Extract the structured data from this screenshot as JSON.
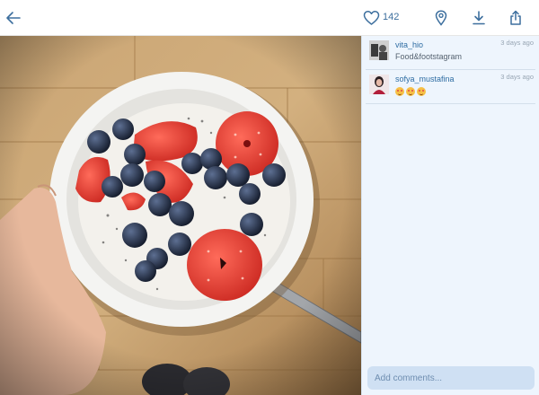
{
  "topbar": {
    "back_icon": "arrow-left-icon",
    "like_icon": "heart-outline-icon",
    "like_count": "142",
    "location_icon": "map-pin-icon",
    "download_icon": "download-icon",
    "share_icon": "share-icon",
    "accent_color": "#3d6f9e"
  },
  "photo": {
    "subject": "bowl of strawberries, blueberries and dragon fruit held in hand"
  },
  "comments": [
    {
      "username": "vita_hio",
      "text": "Food&footstagram",
      "time": "3 days ago"
    },
    {
      "username": "sofya_mustafina",
      "text": "",
      "emoji_count": 3,
      "emoji": "smiling-face-with-heart-eyes",
      "time": "3 days ago"
    }
  ],
  "composer": {
    "placeholder": "Add comments..."
  }
}
